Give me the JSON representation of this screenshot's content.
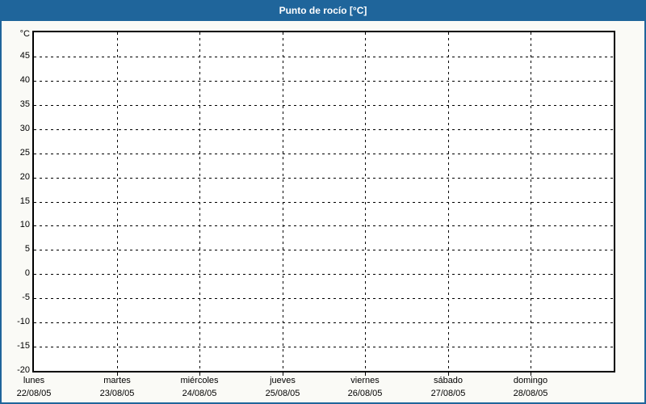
{
  "window": {
    "title": "Punto de rocío [°C]"
  },
  "colors": {
    "accent": "#1f659b",
    "background": "#fafaf6",
    "plot_bg": "#ffffff",
    "grid": "#000000",
    "text": "#000000",
    "title_text": "#ffffff"
  },
  "chart_data": {
    "type": "line",
    "title": "Punto de rocío [°C]",
    "y_unit_label": "°C",
    "ylim": [
      -20,
      50
    ],
    "yticks": [
      45,
      40,
      35,
      30,
      25,
      20,
      15,
      10,
      5,
      0,
      -5,
      -10,
      -15,
      -20
    ],
    "grid": "dashed",
    "legend": "none",
    "x_categories": [
      {
        "day": "lunes",
        "date": "22/08/05"
      },
      {
        "day": "martes",
        "date": "23/08/05"
      },
      {
        "day": "miércoles",
        "date": "24/08/05"
      },
      {
        "day": "jueves",
        "date": "25/08/05"
      },
      {
        "day": "viernes",
        "date": "26/08/05"
      },
      {
        "day": "sábado",
        "date": "27/08/05"
      },
      {
        "day": "domingo",
        "date": "28/08/05"
      }
    ],
    "series": []
  }
}
